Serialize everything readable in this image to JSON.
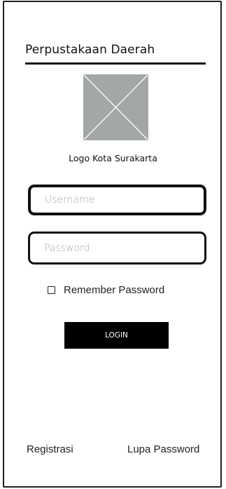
{
  "header": {
    "title": "Perpustakaan Daerah"
  },
  "logo": {
    "icon": "image-placeholder-icon",
    "fill_color": "#a3a7a7",
    "line_color": "#ffffff",
    "caption": "Logo Kota Surakarta"
  },
  "form": {
    "username_placeholder": "Username",
    "username_value": "",
    "password_placeholder": "Password",
    "password_value": "",
    "remember_label": "Remember Password",
    "remember_checked": false,
    "login_label": "LOGIN"
  },
  "footer": {
    "register_label": "Registrasi",
    "forgot_label": "Lupa Password"
  },
  "colors": {
    "text": "#111111",
    "button_bg": "#000000",
    "button_text": "#ffffff",
    "placeholder": "#a9a9a9"
  }
}
